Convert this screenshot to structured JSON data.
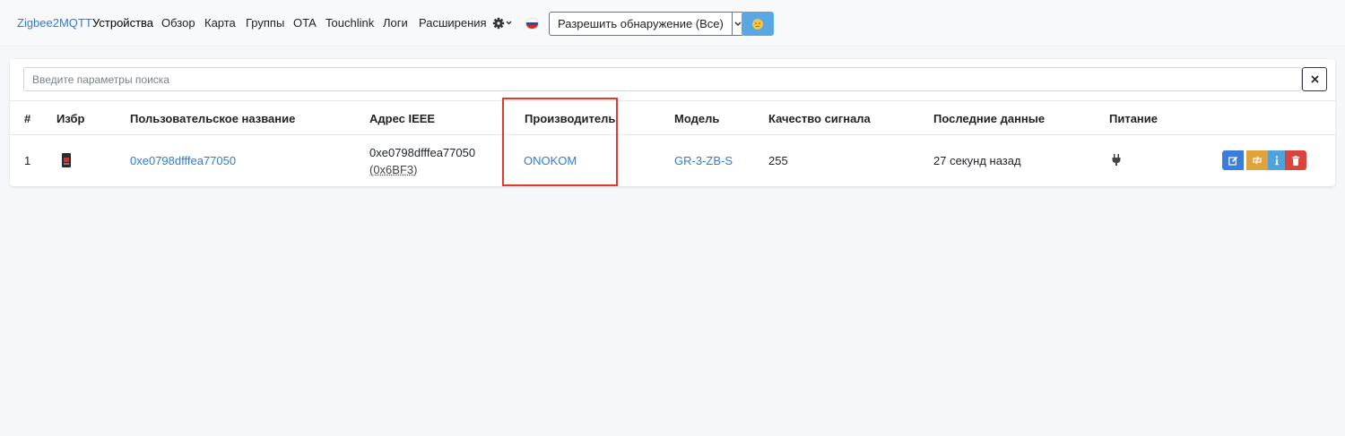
{
  "navbar": {
    "brand": "Zigbee2MQTT",
    "links": [
      "Устройства",
      "Обзор",
      "Карта",
      "Группы",
      "OTA",
      "Touchlink",
      "Логи",
      "Расширения"
    ],
    "settings_icon": "gear-icon",
    "language_flag": "russia-flag-icon",
    "permit_join_label": "Разрешить обнаружение (Все)",
    "theme_icon": "moon-face-icon"
  },
  "search": {
    "placeholder": "Введите параметры поиска",
    "value": ""
  },
  "table": {
    "headers": [
      "#",
      "Избр",
      "Пользовательское название",
      "Адрес IEEE",
      "Производитель",
      "Модель",
      "Качество сигнала",
      "Последние данные",
      "Питание"
    ],
    "rows": [
      {
        "index": "1",
        "friendly_name": "0xe0798dfffea77050",
        "ieee": "0xe0798dfffea77050",
        "nwk": "(0x6BF3)",
        "manufacturer": "ONOKOM",
        "model": "GR-3-ZB-S",
        "lqi": "255",
        "last_seen": "27 секунд назад",
        "power_icon": "plug-icon"
      }
    ]
  },
  "colors": {
    "link": "#2e7bd6",
    "highlight": "#e03a2f",
    "edit": "#3b7ddd",
    "reconfigure": "#e0a23a",
    "info": "#4fa3dc",
    "delete": "#d9453b"
  }
}
